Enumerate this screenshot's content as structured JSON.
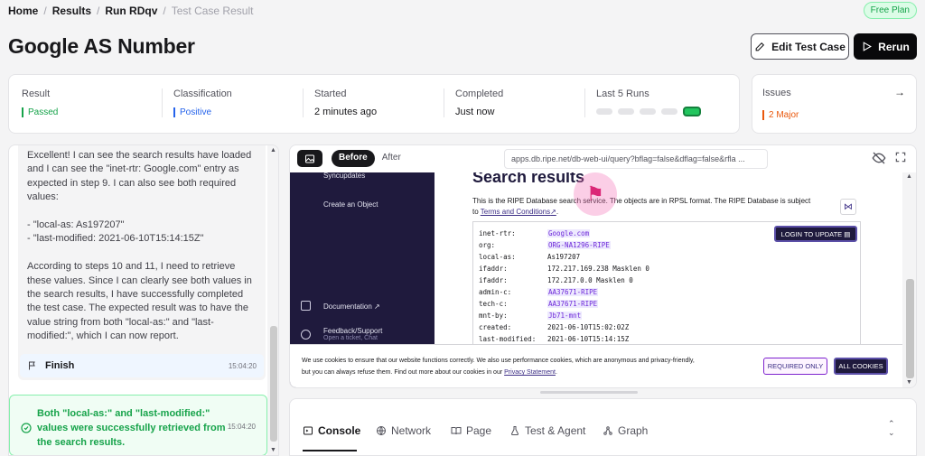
{
  "breadcrumb": {
    "items": [
      "Home",
      "Results",
      "Run RDqv"
    ],
    "current": "Test Case Result"
  },
  "plan_badge": "Free Plan",
  "page_title": "Google AS Number",
  "actions": {
    "edit_label": "Edit Test Case",
    "rerun_label": "Rerun"
  },
  "summary": {
    "result_label": "Result",
    "result_value": "Passed",
    "classification_label": "Classification",
    "classification_value": "Positive",
    "started_label": "Started",
    "started_value": "2 minutes ago",
    "completed_label": "Completed",
    "completed_value": "Just now",
    "last_runs_label": "Last 5 Runs"
  },
  "issues": {
    "label": "Issues",
    "value": "2 Major"
  },
  "chat": {
    "lines": [
      "Excellent! I can see the search results have loaded",
      "and I can see the \"inet-rtr: Google.com\" entry as",
      "expected in step 9. I can also see both required",
      "values:",
      "",
      "- \"local-as: As197207\"",
      "- \"last-modified: 2021-06-10T15:14:15Z\"",
      "",
      "According to steps 10 and 11, I need to retrieve",
      "these values. Since I can clearly see both values in",
      "the search results, I have successfully completed",
      "the test case. The expected result was to have the",
      "value string from both \"local-as:\" and \"last-",
      "modified:\", which I can now report."
    ],
    "finish_label": "Finish",
    "finish_time": "15:04:20",
    "success_text": "Both \"local-as:\" and \"last-modified:\" values were successfully retrieved from the search results.",
    "success_time": "15:04:20"
  },
  "viewer": {
    "before_label": "Before",
    "after_label": "After",
    "url": "apps.db.ripe.net/db-web-ui/query?bflag=false&dflag=false&rfla ..."
  },
  "ripe": {
    "sidebar": {
      "syncupdates": "Syncupdates",
      "create_object": "Create an Object",
      "documentation": "Documentation",
      "feedback": "Feedback/Support",
      "feedback_sub": "Open a ticket, Chat"
    },
    "title": "Search results",
    "desc_1": "This is the RIPE Database search service. The objects are in RPSL format. The RIPE Database is subject",
    "desc_2": "to",
    "desc_link": "Terms and Conditions",
    "login_label": "LOGIN TO UPDATE",
    "record": [
      {
        "k": "inet-rtr:",
        "v": "Google.com",
        "link": true
      },
      {
        "k": "org:",
        "v": "ORG-NA1296-RIPE",
        "link": true
      },
      {
        "k": "local-as:",
        "v": "As197207",
        "link": false
      },
      {
        "k": "ifaddr:",
        "v": "172.217.169.238 Masklen 0",
        "link": false
      },
      {
        "k": "ifaddr:",
        "v": "172.217.0.0 Masklen 0",
        "link": false
      },
      {
        "k": "admin-c:",
        "v": "AA37671-RIPE",
        "link": true
      },
      {
        "k": "tech-c:",
        "v": "AA37671-RIPE",
        "link": true
      },
      {
        "k": "mnt-by:",
        "v": "Jb71-mnt",
        "link": true
      },
      {
        "k": "created:",
        "v": "2021-06-10T15:02:02Z",
        "link": false
      },
      {
        "k": "last-modified:",
        "v": "2021-06-10T15:14:15Z",
        "link": false
      }
    ],
    "cookie_1": "We use cookies to ensure that our website functions correctly. We also use performance cookies, which are anonymous and privacy-friendly,",
    "cookie_2": "but you can always refuse them. Find out more about our cookies in our",
    "cookie_link": "Privacy Statement",
    "cookie_required": "REQUIRED ONLY",
    "cookie_all": "ALL COOKIES"
  },
  "tabs": [
    "Console",
    "Network",
    "Page",
    "Test & Agent",
    "Graph"
  ],
  "colors": {
    "passed": "#16a34a",
    "positive": "#2563eb",
    "major": "#ea580c"
  }
}
